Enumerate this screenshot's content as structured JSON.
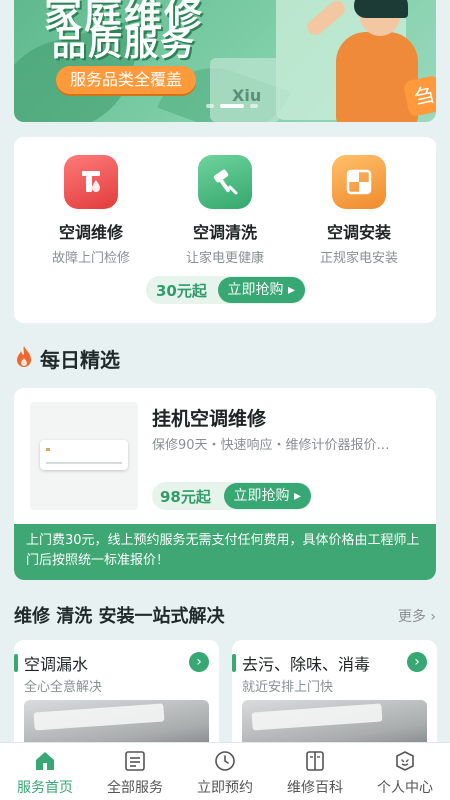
{
  "banner": {
    "title_line1": "家庭维修",
    "title_line2": "品质服务",
    "pill": "服务品类全覆盖",
    "screen_text": "Xiu",
    "badge": "刍"
  },
  "services": {
    "items": [
      {
        "title": "空调维修",
        "sub": "故障上门检修",
        "icon": "repair-icon"
      },
      {
        "title": "空调清洗",
        "sub": "让家电更健康",
        "icon": "clean-icon"
      },
      {
        "title": "空调安装",
        "sub": "正规家电安装",
        "icon": "install-icon"
      }
    ],
    "price": "30元起",
    "buy_label": "立即抢购 ▸"
  },
  "daily": {
    "section_title": "每日精选",
    "item_title": "挂机空调维修",
    "item_desc": "保修90天・快速响应・维修计价器报价…",
    "price": "98元起",
    "buy_label": "立即抢购 ▸",
    "notice": "上门费30元，线上预约服务无需支付任何费用，具体价格由工程师上门后按照统一标准报价！"
  },
  "onestop": {
    "title": "维修 清洗 安装一站式解决",
    "more": "更多 ›",
    "tiles": [
      {
        "title": "空调漏水",
        "sub": "全心全意解决"
      },
      {
        "title": "去污、除味、消毒",
        "sub": "就近安排上门快"
      }
    ]
  },
  "tabbar": {
    "tabs": [
      {
        "label": "服务首页",
        "icon": "home-icon"
      },
      {
        "label": "全部服务",
        "icon": "list-icon"
      },
      {
        "label": "立即预约",
        "icon": "clock-icon"
      },
      {
        "label": "维修百科",
        "icon": "book-icon"
      },
      {
        "label": "个人中心",
        "icon": "user-icon"
      }
    ],
    "active": 0
  },
  "colors": {
    "brand": "#37a774",
    "brand_light": "#e6f4ec",
    "accent_orange": "#ff9a3c"
  }
}
